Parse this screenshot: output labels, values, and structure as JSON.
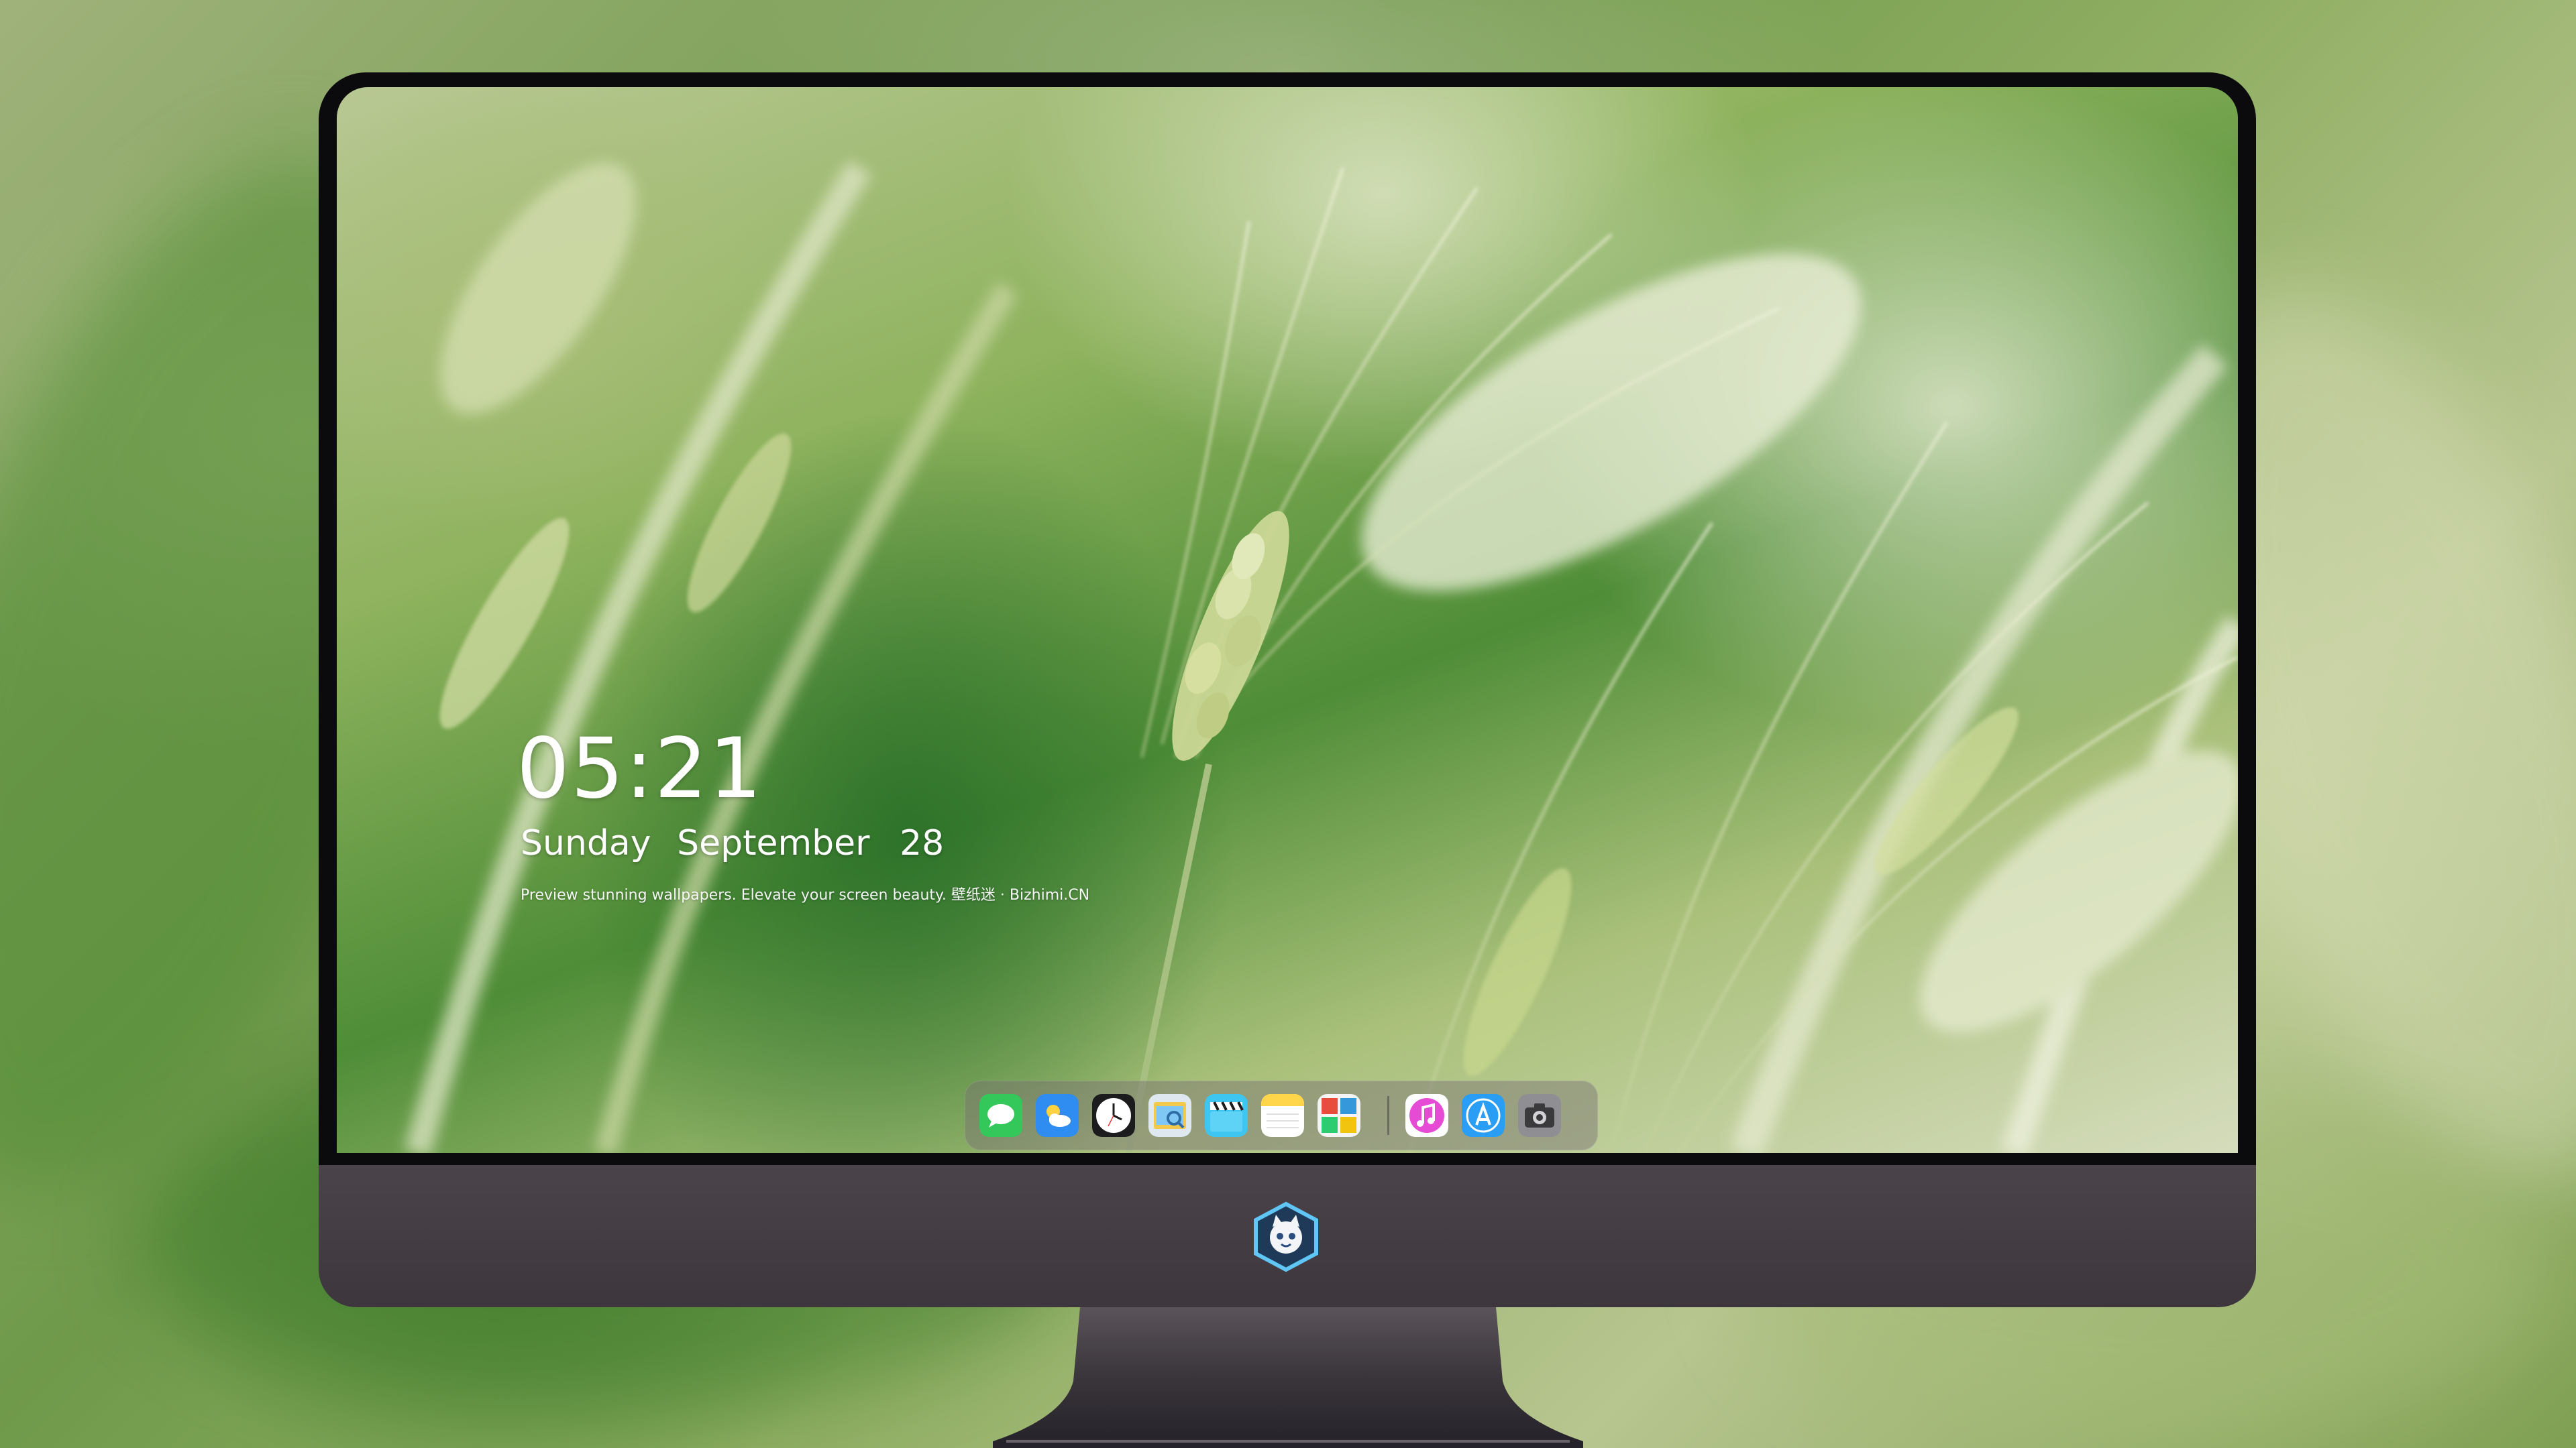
{
  "lock_screen": {
    "time": "05:21",
    "weekday": "Sunday",
    "month": "September",
    "day": "28",
    "tagline": "Preview stunning wallpapers. Elevate your screen beauty. 壁纸迷 · Bizhimi.CN"
  },
  "dock": {
    "apps": [
      {
        "name": "Messages",
        "icon": "messages-icon",
        "color": "#34c759"
      },
      {
        "name": "Weather",
        "icon": "weather-icon",
        "color": "#2f8cf0"
      },
      {
        "name": "Clock",
        "icon": "clock-icon",
        "color": "#1c1c1e"
      },
      {
        "name": "Preview",
        "icon": "preview-icon",
        "color": "#f2c94c"
      },
      {
        "name": "Clips",
        "icon": "clapperboard-icon",
        "color": "#3ec6f0"
      },
      {
        "name": "Notes",
        "icon": "notes-icon",
        "color": "#ffd54a"
      },
      {
        "name": "Photo Booth",
        "icon": "photo-booth-icon",
        "color": "#e74c3c"
      },
      {
        "name": "iTunes",
        "icon": "music-icon",
        "color": "#e64bd6"
      },
      {
        "name": "App Store",
        "icon": "app-store-icon",
        "color": "#2a9df4"
      },
      {
        "name": "Camera",
        "icon": "camera-icon",
        "color": "#8e8e93"
      }
    ]
  },
  "monitor": {
    "logo": "mascot-logo-icon"
  },
  "colors": {
    "bezel": "#0b0b0d",
    "chin": "#463f45",
    "clock_text": "#ffffff"
  }
}
